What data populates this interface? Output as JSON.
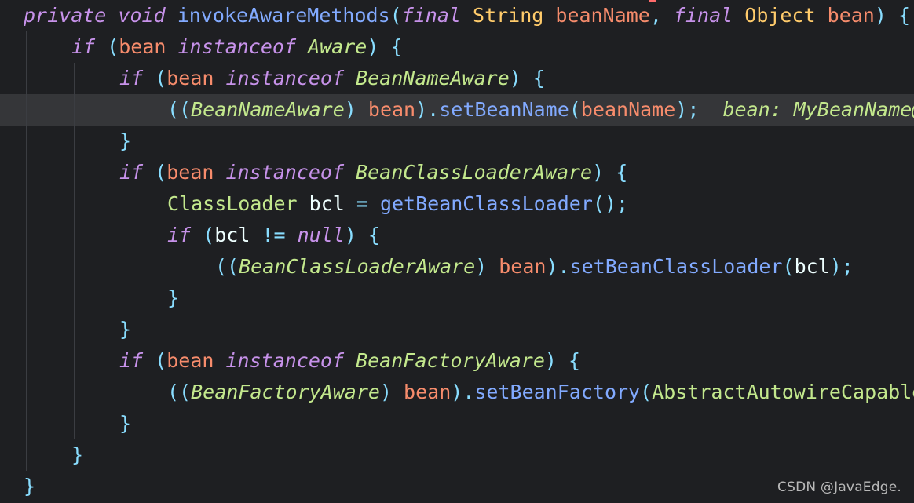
{
  "editor": {
    "language": "Java",
    "lines": [
      {
        "indent": 0,
        "tokens": [
          {
            "t": "private",
            "c": "kw"
          },
          {
            "t": " ",
            "c": "plain"
          },
          {
            "t": "void",
            "c": "kw"
          },
          {
            "t": " ",
            "c": "plain"
          },
          {
            "t": "invokeAwareMethods",
            "c": "fn"
          },
          {
            "t": "(",
            "c": "punc"
          },
          {
            "t": "final",
            "c": "kw"
          },
          {
            "t": " ",
            "c": "plain"
          },
          {
            "t": "String",
            "c": "ty"
          },
          {
            "t": " ",
            "c": "plain"
          },
          {
            "t": "beanName",
            "c": "var"
          },
          {
            "t": ", ",
            "c": "punc"
          },
          {
            "t": "final",
            "c": "kw"
          },
          {
            "t": " ",
            "c": "plain"
          },
          {
            "t": "Object",
            "c": "ty"
          },
          {
            "t": " ",
            "c": "plain"
          },
          {
            "t": "bean",
            "c": "var"
          },
          {
            "t": ") {",
            "c": "punc"
          }
        ]
      },
      {
        "indent": 1,
        "tokens": [
          {
            "t": "if",
            "c": "kw"
          },
          {
            "t": " (",
            "c": "punc"
          },
          {
            "t": "bean",
            "c": "var"
          },
          {
            "t": " ",
            "c": "plain"
          },
          {
            "t": "instanceof",
            "c": "kw"
          },
          {
            "t": " ",
            "c": "plain"
          },
          {
            "t": "Aware",
            "c": "cls"
          },
          {
            "t": ") {",
            "c": "punc"
          }
        ]
      },
      {
        "indent": 2,
        "tokens": [
          {
            "t": "if",
            "c": "kw"
          },
          {
            "t": " (",
            "c": "punc"
          },
          {
            "t": "bean",
            "c": "var"
          },
          {
            "t": " ",
            "c": "plain"
          },
          {
            "t": "instanceof",
            "c": "kw"
          },
          {
            "t": " ",
            "c": "plain"
          },
          {
            "t": "BeanNameAware",
            "c": "cls"
          },
          {
            "t": ") {",
            "c": "punc"
          }
        ]
      },
      {
        "indent": 3,
        "highlight": true,
        "tokens": [
          {
            "t": "((",
            "c": "punc"
          },
          {
            "t": "BeanNameAware",
            "c": "cls"
          },
          {
            "t": ") ",
            "c": "punc"
          },
          {
            "t": "bean",
            "c": "var"
          },
          {
            "t": ").",
            "c": "punc"
          },
          {
            "t": "setBeanName",
            "c": "fn"
          },
          {
            "t": "(",
            "c": "punc"
          },
          {
            "t": "beanName",
            "c": "var"
          },
          {
            "t": ");",
            "c": "punc"
          },
          {
            "t": "  bean: MyBeanName@",
            "c": "dbg"
          }
        ]
      },
      {
        "indent": 2,
        "tokens": [
          {
            "t": "}",
            "c": "punc"
          }
        ]
      },
      {
        "indent": 2,
        "tokens": [
          {
            "t": "if",
            "c": "kw"
          },
          {
            "t": " (",
            "c": "punc"
          },
          {
            "t": "bean",
            "c": "var"
          },
          {
            "t": " ",
            "c": "plain"
          },
          {
            "t": "instanceof",
            "c": "kw"
          },
          {
            "t": " ",
            "c": "plain"
          },
          {
            "t": "BeanClassLoaderAware",
            "c": "cls"
          },
          {
            "t": ") {",
            "c": "punc"
          }
        ]
      },
      {
        "indent": 3,
        "tokens": [
          {
            "t": "ClassLoader",
            "c": "cls2"
          },
          {
            "t": " ",
            "c": "plain"
          },
          {
            "t": "bcl",
            "c": "plain"
          },
          {
            "t": " = ",
            "c": "punc"
          },
          {
            "t": "getBeanClassLoader",
            "c": "fn"
          },
          {
            "t": "();",
            "c": "punc"
          }
        ]
      },
      {
        "indent": 3,
        "tokens": [
          {
            "t": "if",
            "c": "kw"
          },
          {
            "t": " (",
            "c": "punc"
          },
          {
            "t": "bcl",
            "c": "plain"
          },
          {
            "t": " != ",
            "c": "punc"
          },
          {
            "t": "null",
            "c": "kw"
          },
          {
            "t": ") {",
            "c": "punc"
          }
        ]
      },
      {
        "indent": 4,
        "tokens": [
          {
            "t": "((",
            "c": "punc"
          },
          {
            "t": "BeanClassLoaderAware",
            "c": "cls"
          },
          {
            "t": ") ",
            "c": "punc"
          },
          {
            "t": "bean",
            "c": "var"
          },
          {
            "t": ").",
            "c": "punc"
          },
          {
            "t": "setBeanClassLoader",
            "c": "fn"
          },
          {
            "t": "(",
            "c": "punc"
          },
          {
            "t": "bcl",
            "c": "plain"
          },
          {
            "t": ");",
            "c": "punc"
          }
        ]
      },
      {
        "indent": 3,
        "tokens": [
          {
            "t": "}",
            "c": "punc"
          }
        ]
      },
      {
        "indent": 2,
        "tokens": [
          {
            "t": "}",
            "c": "punc"
          }
        ]
      },
      {
        "indent": 2,
        "tokens": [
          {
            "t": "if",
            "c": "kw"
          },
          {
            "t": " (",
            "c": "punc"
          },
          {
            "t": "bean",
            "c": "var"
          },
          {
            "t": " ",
            "c": "plain"
          },
          {
            "t": "instanceof",
            "c": "kw"
          },
          {
            "t": " ",
            "c": "plain"
          },
          {
            "t": "BeanFactoryAware",
            "c": "cls"
          },
          {
            "t": ") {",
            "c": "punc"
          }
        ]
      },
      {
        "indent": 3,
        "tokens": [
          {
            "t": "((",
            "c": "punc"
          },
          {
            "t": "BeanFactoryAware",
            "c": "cls"
          },
          {
            "t": ") ",
            "c": "punc"
          },
          {
            "t": "bean",
            "c": "var"
          },
          {
            "t": ").",
            "c": "punc"
          },
          {
            "t": "setBeanFactory",
            "c": "fn"
          },
          {
            "t": "(",
            "c": "punc"
          },
          {
            "t": "AbstractAutowireCapable",
            "c": "cls2"
          }
        ]
      },
      {
        "indent": 2,
        "tokens": [
          {
            "t": "}",
            "c": "punc"
          }
        ]
      },
      {
        "indent": 1,
        "tokens": [
          {
            "t": "}",
            "c": "punc"
          }
        ]
      },
      {
        "indent": 0,
        "tokens": [
          {
            "t": "}",
            "c": "punc"
          }
        ]
      }
    ]
  },
  "watermark": "CSDN @JavaEdge.",
  "colors": {
    "background": "#1e1f22",
    "current_line": "#353639",
    "keyword": "#c792ea",
    "function": "#82aaff",
    "type": "#ffcb6b",
    "variable": "#f78c6c",
    "class": "#c3e88d",
    "punctuation": "#89ddff",
    "plain": "#eeffff"
  }
}
